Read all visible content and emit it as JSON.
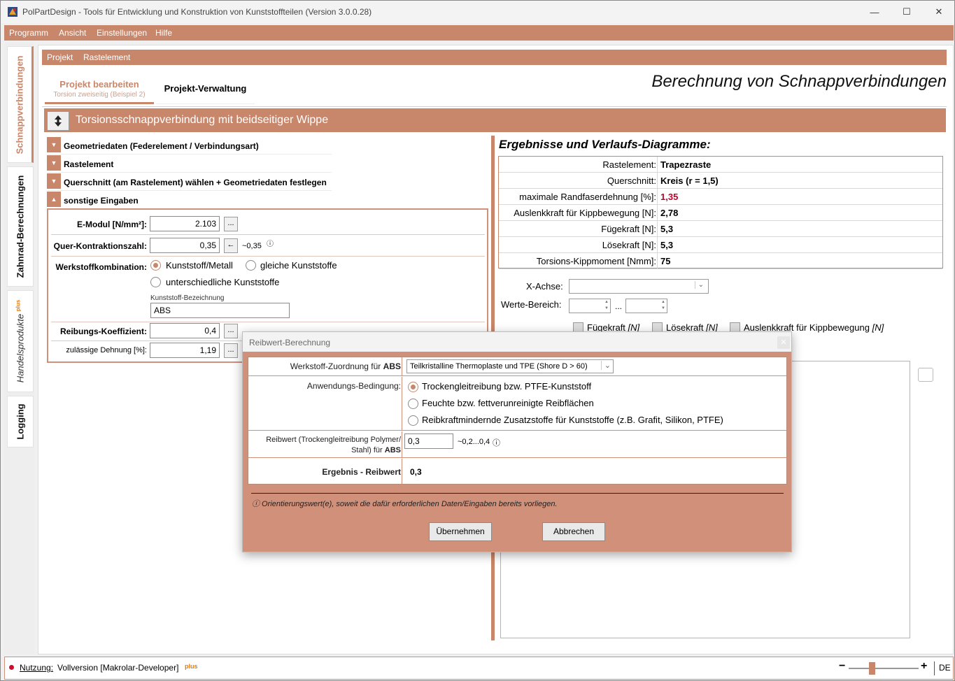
{
  "window": {
    "title": "PolPartDesign - Tools für Entwicklung und Konstruktion von Kunststoffteilen (Version 3.0.0.28)",
    "minimize": "—",
    "maximize": "☐",
    "close": "✕"
  },
  "menu": [
    "Programm",
    "Ansicht",
    "Einstellungen",
    "Hilfe"
  ],
  "side_tabs": {
    "t1": "Schnappverbindungen",
    "t2": "Zahnrad-Berechnungen",
    "t3": "Handelsprodukte",
    "t3_plus": "plus",
    "t4": "Logging"
  },
  "subbar": [
    "Projekt",
    "Rastelement"
  ],
  "tabs": {
    "edit": "Projekt bearbeiten",
    "edit_sub": "Torsion zweiseitig (Beispiel 2)",
    "manage": "Projekt-Verwaltung"
  },
  "page_title": "Berechnung von Schnappverbindungen",
  "section_header": "Torsionsschnappverbindung mit beidseitiger Wippe",
  "sections": [
    "Geometriedaten (Federelement / Verbindungsart)",
    "Rastelement",
    "Querschnitt (am Rastelement) wählen + Geometriedaten festlegen",
    "sonstige Eingaben"
  ],
  "inputs": {
    "emodul_label": "E-Modul [N/mm²]:",
    "emodul": "2.103",
    "dots": "...",
    "quer_label": "Quer-Kontraktionszahl:",
    "quer": "0,35",
    "arrow": "←",
    "quer_hint": "~0,35",
    "info": "ⓘ",
    "werkstoff_label": "Werkstoffkombination:",
    "opt1": "Kunststoff/Metall",
    "opt2": "gleiche Kunststoffe",
    "opt3": "unterschiedliche Kunststoffe",
    "kb_label": "Kunststoff-Bezeichnung",
    "kb_value": "ABS",
    "reib_label": "Reibungs-Koeffizient:",
    "reib": "0,4",
    "dehn_label": "zulässige Dehnung [%]:",
    "dehn": "1,19"
  },
  "results": {
    "title": "Ergebnisse und Verlaufs-Diagramme:",
    "rows": [
      {
        "k": "Rastelement:",
        "v": "Trapezraste"
      },
      {
        "k": "Querschnitt:",
        "v": "Kreis (r = 1,5)"
      },
      {
        "k": "maximale Randfaserdehnung [%]:",
        "v": "1,35"
      },
      {
        "k": "Auslenkkraft für Kippbewegung [N]:",
        "v": "2,78"
      },
      {
        "k": "Fügekraft [N]:",
        "v": "5,3"
      },
      {
        "k": "Lösekraft [N]:",
        "v": "5,3"
      },
      {
        "k": "Torsions-Kippmoment [Nmm]:",
        "v": "75"
      }
    ],
    "highlight_color": "#c0002a"
  },
  "chart_controls": {
    "xachse": "X-Achse:",
    "werte": "Werte-Bereich:",
    "ellipsis": "...",
    "c1": "Fügekraft",
    "c2": "Lösekraft",
    "c3": "Auslenkkraft für Kippbewegung",
    "unit": "[N]"
  },
  "status": {
    "nutzung": "Nutzung:",
    "version": "Vollversion [Makrolar-Developer]",
    "plus": "plus",
    "minus": "−",
    "plussign": "+",
    "lang": "DE"
  },
  "dialog": {
    "title": "Reibwert-Berechnung",
    "close": "✕",
    "zuord_label": "Werkstoff-Zuordnung für",
    "zuord_mat": "ABS",
    "zuord_value": "Teilkristalline Thermoplaste und TPE (Shore D > 60)",
    "anw_label": "Anwendungs-Bedingung:",
    "anw_opts": [
      "Trockengleitreibung bzw. PTFE-Kunststoff",
      "Feuchte bzw. fettverunreinigte Reibflächen",
      "Reibkraftmindernde Zusatzstoffe für Kunststoffe (z.B. Grafit, Silikon, PTFE)"
    ],
    "rw_label1": "Reibwert (Trockengleitreibung Polymer/",
    "rw_label2": "Stahl) für",
    "rw_mat": "ABS",
    "rw_value": "0,3",
    "rw_hint": "~0,2...0,4",
    "info": "ⓘ",
    "erg_label": "Ergebnis - Reibwert",
    "erg_value": "0,3",
    "note": "ⓘ Orientierungswert(e), soweit die dafür erforderlichen Daten/Eingaben bereits vorliegen.",
    "ok": "Übernehmen",
    "cancel": "Abbrechen"
  },
  "colors": {
    "accent": "#c8866a",
    "dialog_bg": "#d0907a"
  }
}
